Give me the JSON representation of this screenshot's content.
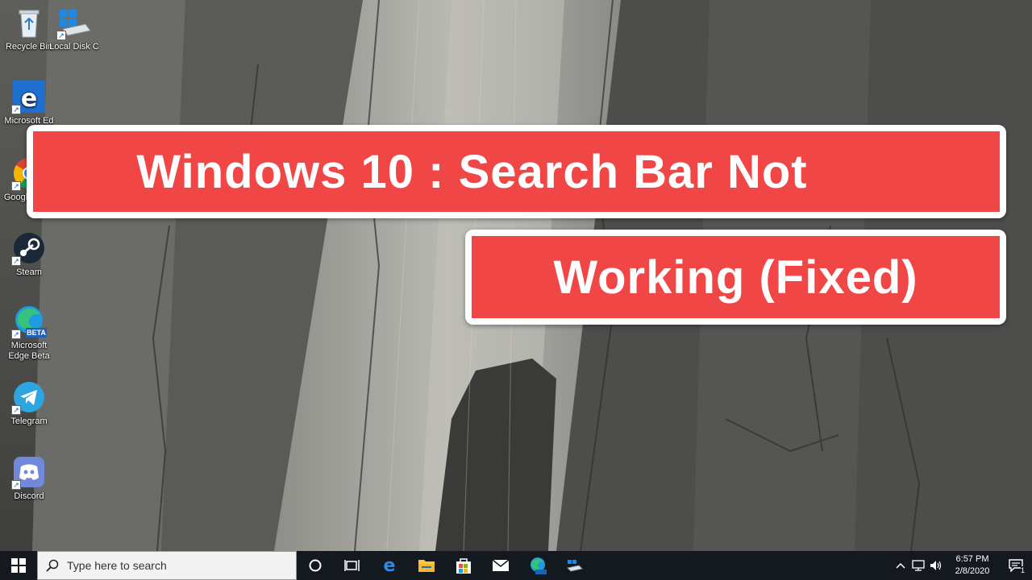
{
  "desktop": {
    "icons": [
      {
        "label": "Recycle Bin",
        "icon": "recycle-bin-icon"
      },
      {
        "label": "Local Disk C",
        "icon": "drive-icon"
      },
      {
        "label": "Microsoft Ed",
        "icon": "edge-icon"
      },
      {
        "label": "Google Chro",
        "icon": "chrome-icon"
      },
      {
        "label": "Steam",
        "icon": "steam-icon"
      },
      {
        "label": "Microsoft Edge Beta",
        "icon": "edge-beta-icon",
        "badge": "BETA"
      },
      {
        "label": "Telegram",
        "icon": "telegram-icon"
      },
      {
        "label": "Discord",
        "icon": "discord-icon"
      }
    ]
  },
  "banners": {
    "line1": "Windows 10 : Search Bar Not",
    "line2": "Working (Fixed)"
  },
  "taskbar": {
    "search_placeholder": "Type here to search",
    "pinned": [
      "task-view-icon",
      "edge-icon",
      "file-explorer-icon",
      "store-icon",
      "mail-icon",
      "edge-beta-icon",
      "drive-icon"
    ]
  },
  "tray": {
    "time": "6:57 PM",
    "date": "2/8/2020",
    "notification_count": "1"
  },
  "colors": {
    "banner_red": "#f04646",
    "taskbar": "#14191f",
    "search_bg": "#f3f3f3"
  }
}
